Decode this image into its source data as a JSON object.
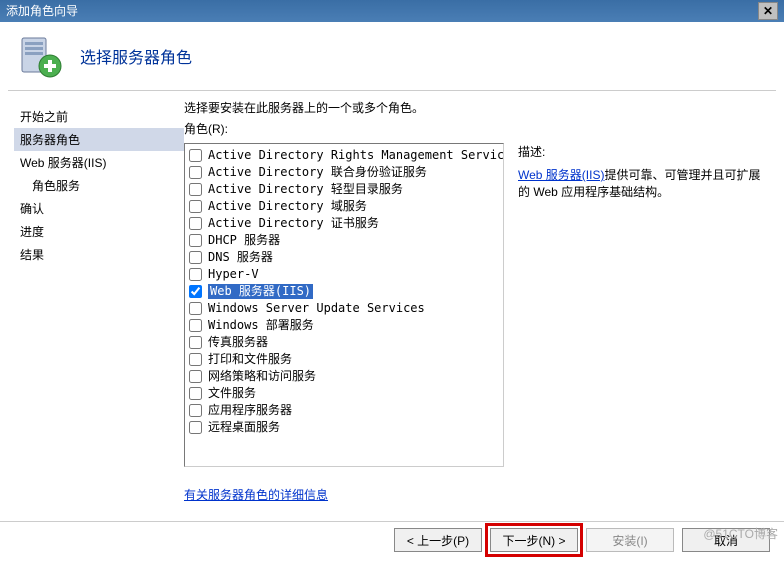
{
  "window": {
    "title": "添加角色向导"
  },
  "header": {
    "title": "选择服务器角色"
  },
  "sidebar": {
    "items": [
      {
        "label": "开始之前",
        "selected": false,
        "indent": 0
      },
      {
        "label": "服务器角色",
        "selected": true,
        "indent": 0
      },
      {
        "label": "Web 服务器(IIS)",
        "selected": false,
        "indent": 0
      },
      {
        "label": "角色服务",
        "selected": false,
        "indent": 1
      },
      {
        "label": "确认",
        "selected": false,
        "indent": 0
      },
      {
        "label": "进度",
        "selected": false,
        "indent": 0
      },
      {
        "label": "结果",
        "selected": false,
        "indent": 0
      }
    ]
  },
  "main": {
    "instruction": "选择要安装在此服务器上的一个或多个角色。",
    "roles_label": "角色(R):",
    "roles": [
      {
        "label": "Active Directory Rights Management Services",
        "checked": false,
        "highlight": false
      },
      {
        "label": "Active Directory 联合身份验证服务",
        "checked": false,
        "highlight": false
      },
      {
        "label": "Active Directory 轻型目录服务",
        "checked": false,
        "highlight": false
      },
      {
        "label": "Active Directory 域服务",
        "checked": false,
        "highlight": false
      },
      {
        "label": "Active Directory 证书服务",
        "checked": false,
        "highlight": false
      },
      {
        "label": "DHCP 服务器",
        "checked": false,
        "highlight": false
      },
      {
        "label": "DNS 服务器",
        "checked": false,
        "highlight": false
      },
      {
        "label": "Hyper-V",
        "checked": false,
        "highlight": false
      },
      {
        "label": "Web 服务器(IIS)",
        "checked": true,
        "highlight": true
      },
      {
        "label": "Windows Server Update Services",
        "checked": false,
        "highlight": false
      },
      {
        "label": "Windows 部署服务",
        "checked": false,
        "highlight": false
      },
      {
        "label": "传真服务器",
        "checked": false,
        "highlight": false
      },
      {
        "label": "打印和文件服务",
        "checked": false,
        "highlight": false
      },
      {
        "label": "网络策略和访问服务",
        "checked": false,
        "highlight": false
      },
      {
        "label": "文件服务",
        "checked": false,
        "highlight": false
      },
      {
        "label": "应用程序服务器",
        "checked": false,
        "highlight": false
      },
      {
        "label": "远程桌面服务",
        "checked": false,
        "highlight": false
      }
    ],
    "description": {
      "title": "描述:",
      "link_text": "Web 服务器(IIS)",
      "body": "提供可靠、可管理并且可扩展的 Web 应用程序基础结构。"
    },
    "more_info_link": "有关服务器角色的详细信息"
  },
  "footer": {
    "prev": "< 上一步(P)",
    "next": "下一步(N) >",
    "install": "安装(I)",
    "cancel": "取消"
  },
  "watermark": "@51CTO博客"
}
